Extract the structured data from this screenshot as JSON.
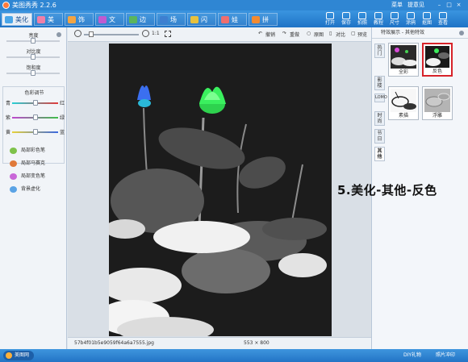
{
  "window": {
    "title": "美图秀秀 2.2.6",
    "menu": [
      "菜单",
      "提意见"
    ],
    "controls": [
      "min",
      "max",
      "close"
    ]
  },
  "tabs": [
    {
      "label": "美化",
      "color": "#49a5e8"
    },
    {
      "label": "美容",
      "color": "#f07fa7"
    },
    {
      "label": "饰品",
      "color": "#f3a442"
    },
    {
      "label": "文字",
      "color": "#c05bd0"
    },
    {
      "label": "边框",
      "color": "#5bb55c"
    },
    {
      "label": "场景",
      "color": "#3e7fd0"
    },
    {
      "label": "闪图",
      "color": "#e8c13c"
    },
    {
      "label": "娃娃",
      "color": "#ef6e6e"
    },
    {
      "label": "拼图",
      "color": "#f28a30"
    }
  ],
  "toolbar_buttons": [
    "打开",
    "保存",
    "拍照",
    "教程",
    "尺寸",
    "涂鸦",
    "抠图",
    "查看"
  ],
  "left_panel": {
    "adjust": [
      {
        "label": "亮度",
        "value": 0.5
      },
      {
        "label": "对比度",
        "value": 0.5
      },
      {
        "label": "饱和度",
        "value": 0.5
      }
    ],
    "color_section_title": "色彩调节",
    "color_rows": [
      {
        "left": "青",
        "right": "红",
        "value": 0.5
      },
      {
        "left": "紫",
        "right": "绿",
        "value": 0.5
      },
      {
        "left": "黄",
        "right": "蓝",
        "value": 0.5
      }
    ],
    "tools": [
      {
        "label": "局部彩色笔",
        "color": "#7ec24a"
      },
      {
        "label": "局部马赛克",
        "color": "#e07a3a"
      },
      {
        "label": "局部变色笔",
        "color": "#c967d8"
      },
      {
        "label": "背景虚化",
        "color": "#5aa3e5"
      }
    ]
  },
  "subbar": {
    "zoom_label": "1:1",
    "actions": [
      "撤销",
      "重做",
      "原图",
      "对比",
      "预览"
    ]
  },
  "status": {
    "filename": "57b4f01b5e9059f64a6a7555.jpg",
    "dimensions": "553 × 800"
  },
  "right_panel": {
    "header": "特效展示 - 其他特效",
    "vertical_tabs": [
      "热门",
      "影楼",
      "LOMO",
      "时尚",
      "节日",
      "其他"
    ],
    "active_tab": "其他",
    "effects": [
      {
        "label": "全彩",
        "selected": false
      },
      {
        "label": "反色",
        "selected": true
      },
      {
        "label": "素描",
        "selected": false
      },
      {
        "label": "浮雕",
        "selected": false
      }
    ]
  },
  "annotation": "5.美化-其他-反色",
  "taskbar": {
    "brand": "美图网",
    "right_items": [
      "DIY礼物",
      "照片冲印"
    ]
  }
}
